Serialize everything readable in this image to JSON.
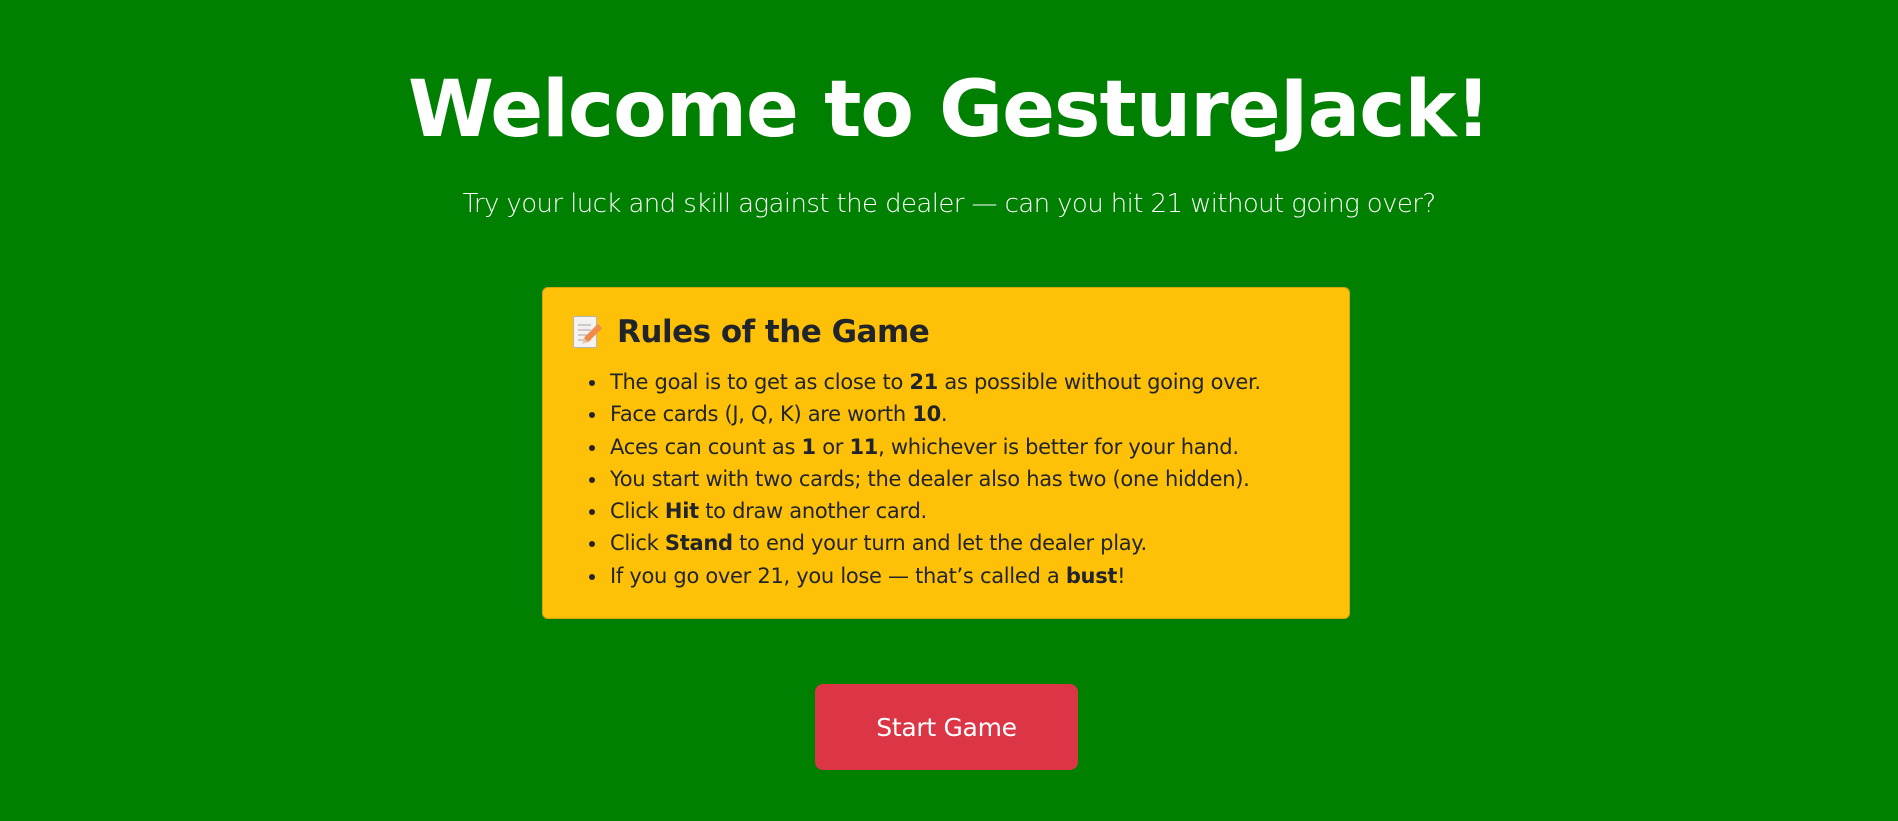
{
  "header": {
    "title": "Welcome to GestureJack!",
    "subtitle": "Try your luck and skill against the dealer — can you hit 21 without going over?"
  },
  "rules": {
    "icon": "memo-icon",
    "heading": "Rules of the Game",
    "items": [
      {
        "parts": [
          "The goal is to get as close to ",
          "21",
          " as possible without going over."
        ]
      },
      {
        "parts": [
          "Face cards (J, Q, K) are worth ",
          "10",
          "."
        ]
      },
      {
        "parts": [
          "Aces can count as ",
          "1",
          " or ",
          "11",
          ", whichever is better for your hand."
        ]
      },
      {
        "parts": [
          "You start with two cards; the dealer also has two (one hidden)."
        ]
      },
      {
        "parts": [
          "Click ",
          "Hit",
          " to draw another card."
        ]
      },
      {
        "parts": [
          "Click ",
          "Stand",
          " to end your turn and let the dealer play."
        ]
      },
      {
        "parts": [
          "If you go over 21, you lose — that’s called a ",
          "bust",
          "!"
        ]
      }
    ]
  },
  "actions": {
    "start_label": "Start Game"
  },
  "colors": {
    "background": "#008000",
    "card": "#ffc107",
    "button": "#dc3545"
  }
}
